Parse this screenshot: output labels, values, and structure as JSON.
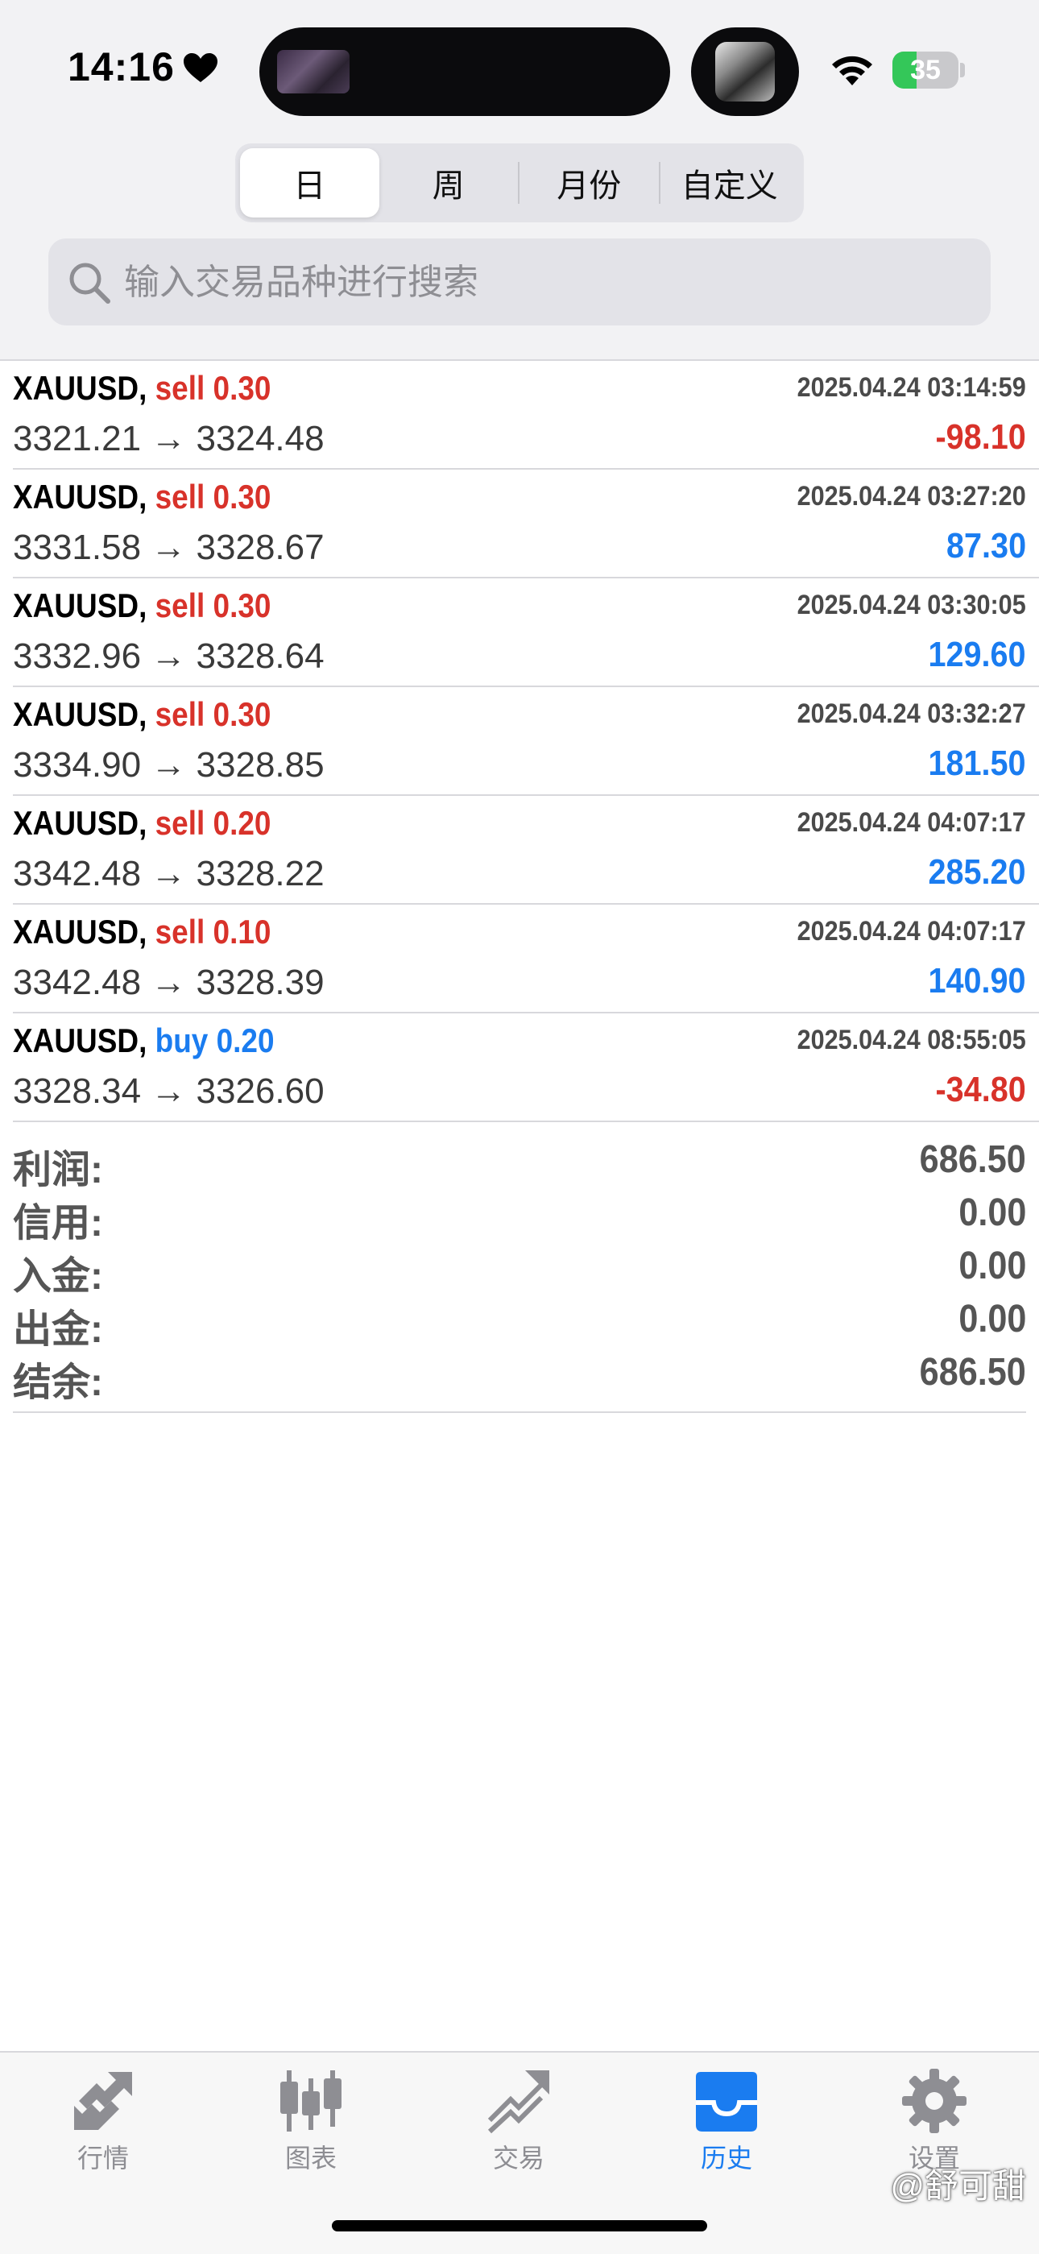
{
  "status_bar": {
    "time": "14:16",
    "battery": "35"
  },
  "segments": [
    {
      "label": "日",
      "active": true
    },
    {
      "label": "周",
      "active": false
    },
    {
      "label": "月份",
      "active": false
    },
    {
      "label": "自定义",
      "active": false
    }
  ],
  "search": {
    "placeholder": "输入交易品种进行搜索"
  },
  "trades": [
    {
      "symbol": "XAUUSD,",
      "side": "sell",
      "volume": "0.30",
      "time": "2025.04.24 03:14:59",
      "open": "3321.21",
      "close": "3324.48",
      "profit": "-98.10"
    },
    {
      "symbol": "XAUUSD,",
      "side": "sell",
      "volume": "0.30",
      "time": "2025.04.24 03:27:20",
      "open": "3331.58",
      "close": "3328.67",
      "profit": "87.30"
    },
    {
      "symbol": "XAUUSD,",
      "side": "sell",
      "volume": "0.30",
      "time": "2025.04.24 03:30:05",
      "open": "3332.96",
      "close": "3328.64",
      "profit": "129.60"
    },
    {
      "symbol": "XAUUSD,",
      "side": "sell",
      "volume": "0.30",
      "time": "2025.04.24 03:32:27",
      "open": "3334.90",
      "close": "3328.85",
      "profit": "181.50"
    },
    {
      "symbol": "XAUUSD,",
      "side": "sell",
      "volume": "0.20",
      "time": "2025.04.24 04:07:17",
      "open": "3342.48",
      "close": "3328.22",
      "profit": "285.20"
    },
    {
      "symbol": "XAUUSD,",
      "side": "sell",
      "volume": "0.10",
      "time": "2025.04.24 04:07:17",
      "open": "3342.48",
      "close": "3328.39",
      "profit": "140.90"
    },
    {
      "symbol": "XAUUSD,",
      "side": "buy",
      "volume": "0.20",
      "time": "2025.04.24 08:55:05",
      "open": "3328.34",
      "close": "3326.60",
      "profit": "-34.80"
    }
  ],
  "arrow": "→",
  "summary": [
    {
      "label": "利润:",
      "value": "686.50"
    },
    {
      "label": "信用:",
      "value": "0.00"
    },
    {
      "label": "入金:",
      "value": "0.00"
    },
    {
      "label": "出金:",
      "value": "0.00"
    },
    {
      "label": "结余:",
      "value": "686.50"
    }
  ],
  "tabs": [
    {
      "label": "行情",
      "icon": "quotes-icon",
      "active": false
    },
    {
      "label": "图表",
      "icon": "chart-icon",
      "active": false
    },
    {
      "label": "交易",
      "icon": "trade-icon",
      "active": false
    },
    {
      "label": "历史",
      "icon": "history-icon",
      "active": true
    },
    {
      "label": "设置",
      "icon": "settings-icon",
      "active": false
    }
  ],
  "watermark": "@舒可甜",
  "colors": {
    "sell": "#d8322a",
    "buy": "#1a7cf0",
    "profit_positive": "#1a7cf0",
    "profit_negative": "#d8322a",
    "tab_active": "#1a7cf0",
    "tab_inactive": "#8e8e93"
  }
}
